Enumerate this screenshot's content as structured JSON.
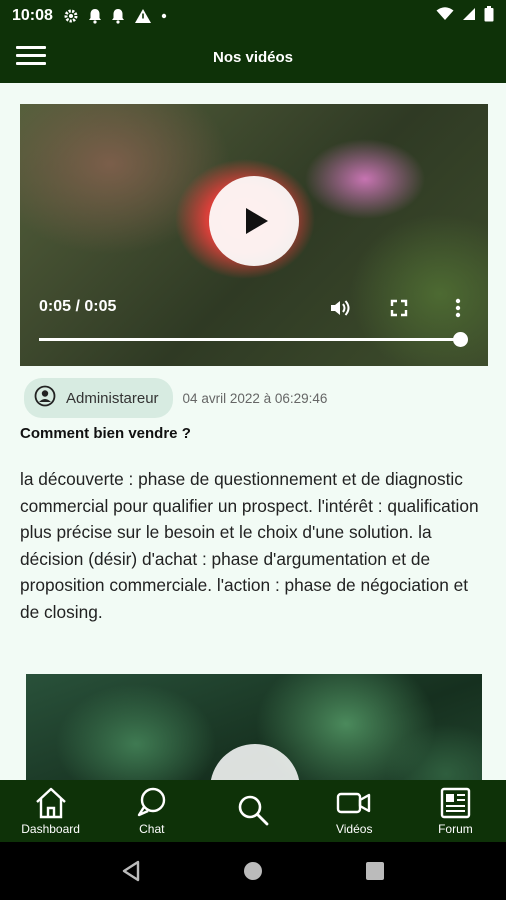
{
  "status_bar": {
    "time": "10:08"
  },
  "app_bar": {
    "title": "Nos vidéos"
  },
  "video": {
    "time_display": "0:05 / 0:05",
    "progress": 1.0
  },
  "post": {
    "author": "Administareur",
    "date": "04 avril 2022 à 06:29:46",
    "title": "Comment bien vendre ?",
    "body": "la découverte : phase de questionnement et de diagnostic commercial pour qualifier un prospect. l'intérêt : qualification plus précise sur le besoin et le choix d'une solution. la décision (désir) d'achat : phase d'argumentation et de proposition commerciale. l'action : phase de négociation et de closing."
  },
  "bottom_nav": [
    {
      "label": "Dashboard",
      "icon": "home-icon"
    },
    {
      "label": "Chat",
      "icon": "chat-icon"
    },
    {
      "label": "",
      "icon": "search-icon"
    },
    {
      "label": "Vidéos",
      "icon": "video-camera-icon"
    },
    {
      "label": "Forum",
      "icon": "newspaper-icon"
    }
  ],
  "colors": {
    "primary": "#0e3208",
    "background": "#f2fbf5",
    "author_chip": "#d7ebe1"
  }
}
